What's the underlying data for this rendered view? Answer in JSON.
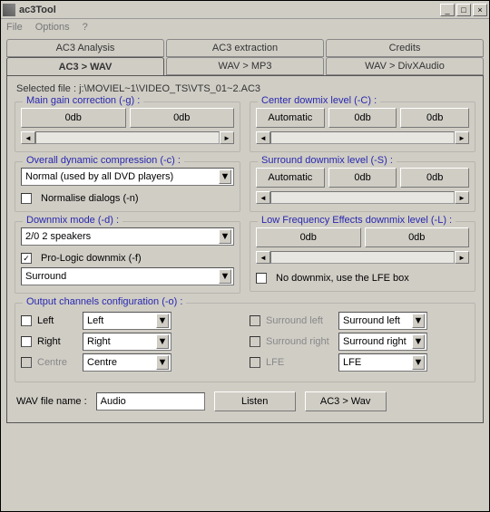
{
  "window": {
    "title": "ac3Tool"
  },
  "menu": {
    "file": "File",
    "options": "Options",
    "help": "?"
  },
  "tabs_top": {
    "analysis": "AC3 Analysis",
    "extraction": "AC3 extraction",
    "credits": "Credits"
  },
  "tabs_bottom": {
    "ac3wav": "AC3 > WAV",
    "wavmp3": "WAV > MP3",
    "wavdivx": "WAV > DivXAudio"
  },
  "selected_file_label": "Selected file :",
  "selected_file": "j:\\MOVIEL~1\\VIDEO_TS\\VTS_01~2.AC3",
  "main_gain": {
    "legend": "Main gain correction (-g) :",
    "v1": "0db",
    "v2": "0db"
  },
  "center": {
    "legend": "Center dowmix level (-C) :",
    "auto": "Automatic",
    "v1": "0db",
    "v2": "0db"
  },
  "dyn": {
    "legend": "Overall dynamic compression (-c) :",
    "value": "Normal (used by all DVD players)",
    "norm_label": "Normalise dialogs (-n)"
  },
  "surround": {
    "legend": "Surround downmix level (-S) :",
    "auto": "Automatic",
    "v1": "0db",
    "v2": "0db"
  },
  "downmix": {
    "legend": "Downmix mode (-d) :",
    "mode": "2/0 2 speakers",
    "prologic_label": "Pro-Logic downmix (-f)",
    "prologic_value": "Surround"
  },
  "lfe": {
    "legend": "Low Frequency Effects downmix level (-L) :",
    "v1": "0db",
    "v2": "0db",
    "nolfe_label": "No downmix, use the LFE box"
  },
  "output": {
    "legend": "Output channels configuration (-o) :",
    "left": "Left",
    "right": "Right",
    "centre": "Centre",
    "surround_left": "Surround left",
    "surround_right": "Surround right",
    "lfe": "LFE",
    "sel_left": "Left",
    "sel_right": "Right",
    "sel_centre": "Centre",
    "sel_sleft": "Surround left",
    "sel_sright": "Surround right",
    "sel_lfe": "LFE"
  },
  "bottom": {
    "wav_label": "WAV file name :",
    "wav_value": "Audio",
    "listen": "Listen",
    "go": "AC3 > Wav"
  },
  "arrows": {
    "down": "▼",
    "left": "◄",
    "right": "►"
  }
}
